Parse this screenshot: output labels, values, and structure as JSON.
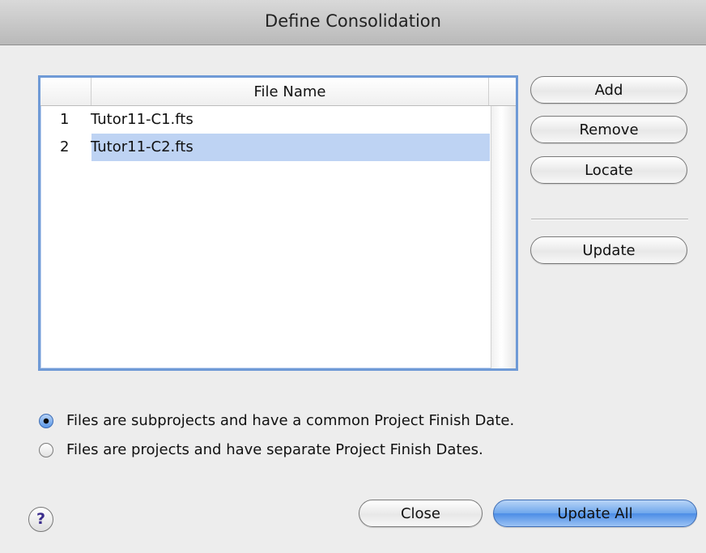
{
  "window": {
    "title": "Define Consolidation"
  },
  "table": {
    "column_header": "File Name",
    "rows": [
      {
        "index": "1",
        "name": "Tutor11-C1.fts",
        "selected": false
      },
      {
        "index": "2",
        "name": "Tutor11-C2.fts",
        "selected": true
      }
    ]
  },
  "side_buttons": {
    "add": "Add",
    "remove": "Remove",
    "locate": "Locate",
    "update": "Update"
  },
  "options": {
    "subprojects_label": "Files are subprojects and have a common Project Finish Date.",
    "projects_label": "Files are projects and have separate Project Finish Dates.",
    "selected": "subprojects"
  },
  "footer": {
    "help_label": "?",
    "close_label": "Close",
    "update_all_label": "Update All"
  },
  "colors": {
    "selection": "#bed3f3",
    "accent": "#4b8de6",
    "focus_ring": "#6f9ad6"
  }
}
